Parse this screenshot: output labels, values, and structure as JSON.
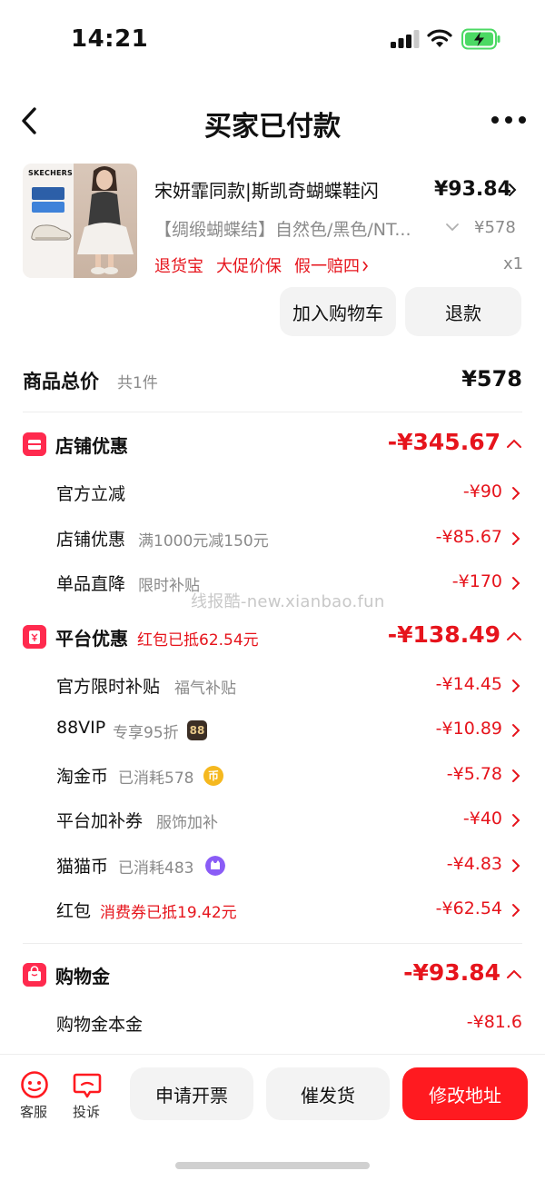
{
  "status_bar": {
    "time": "14:21",
    "icons": [
      "signal-icon",
      "wifi-icon",
      "battery-charging-icon"
    ]
  },
  "nav": {
    "title": "买家已付款",
    "back_icon": "chevron-left-icon",
    "more_icon": "more-dots-icon"
  },
  "product": {
    "image_brand": "SKECHERS",
    "name": "宋妍霏同款|斯凯奇蝴蝶鞋闪",
    "price": "¥93.84",
    "spec": "【绸缎蝴蝶结】自然色/黑色/NT...",
    "original_price": "¥578",
    "tags": [
      "退货宝",
      "大促价保",
      "假一赔四"
    ],
    "quantity": "x1",
    "add_cart_label": "加入购物车",
    "refund_label": "退款"
  },
  "total": {
    "label": "商品总价",
    "count": "共1件",
    "value": "¥578"
  },
  "shop_discount": {
    "label": "店铺优惠",
    "value": "-¥345.67",
    "items": [
      {
        "label": "官方立减",
        "note": "",
        "value": "-¥90"
      },
      {
        "label": "店铺优惠",
        "note": "满1000元减150元",
        "value": "-¥85.67"
      },
      {
        "label": "单品直降",
        "note": "限时补贴",
        "value": "-¥170"
      }
    ]
  },
  "platform_discount": {
    "label": "平台优惠",
    "sub": "红包已抵62.54元",
    "value": "-¥138.49",
    "items": [
      {
        "label": "官方限时补贴",
        "note": "福气补贴",
        "value": "-¥14.45"
      },
      {
        "label": "88VIP",
        "note": "专享95折",
        "value": "-¥10.89",
        "badge": "88"
      },
      {
        "label": "淘金币",
        "note": "已消耗578",
        "value": "-¥5.78",
        "badge": "币"
      },
      {
        "label": "平台加补券",
        "note": "服饰加补",
        "value": "-¥40"
      },
      {
        "label": "猫猫币",
        "note": "已消耗483",
        "value": "-¥4.83"
      },
      {
        "label": "红包",
        "note": "消费券已抵19.42元",
        "value": "-¥62.54"
      }
    ]
  },
  "shopping_credit": {
    "label": "购物金",
    "value": "-¥93.84",
    "items": [
      {
        "label": "购物金本金",
        "value": "-¥81.6"
      }
    ]
  },
  "watermark": "线报酷-new.xianbao.fun",
  "bottom_bar": {
    "service_label": "客服",
    "complain_label": "投诉",
    "invoice_label": "申请开票",
    "urge_label": "催发货",
    "address_label": "修改地址"
  },
  "colors": {
    "accent": "#ff1a20",
    "price_red": "#e6141c",
    "gray_text": "#8a8a8a"
  }
}
